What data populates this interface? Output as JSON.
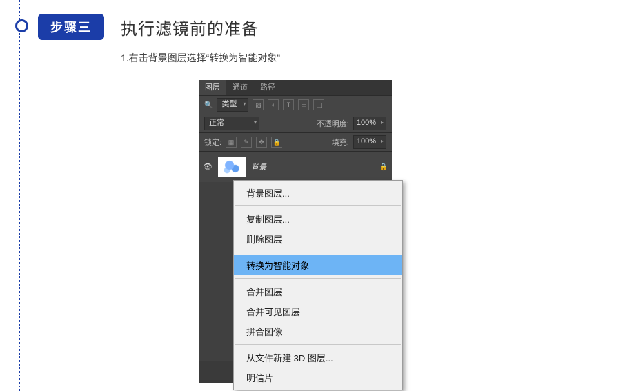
{
  "step": {
    "badge": "步骤三",
    "title": "执行滤镜前的准备",
    "desc": "1.右击背景图层选择“转换为智能对象”"
  },
  "panel": {
    "tabs": {
      "layers": "图层",
      "channels": "通道",
      "paths": "路径"
    },
    "filter_label": "类型",
    "blend_mode": "正常",
    "opacity_label": "不透明度:",
    "opacity_value": "100%",
    "lock_label": "锁定:",
    "fill_label": "填充:",
    "fill_value": "100%",
    "layer_name": "背景"
  },
  "context_menu": {
    "items": [
      "背景图层...",
      "复制图层...",
      "删除图层",
      "转换为智能对象",
      "合并图层",
      "合并可见图层",
      "拼合图像",
      "从文件新建 3D 图层...",
      "明信片"
    ]
  }
}
